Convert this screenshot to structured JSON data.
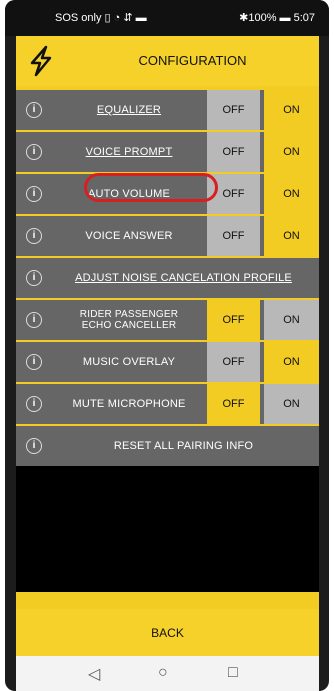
{
  "status": {
    "left": "SOS only ▯ ◔ ⇵ ▬",
    "right": "✱100% ▬ 5:07"
  },
  "header": {
    "title": "CONFIGURATION"
  },
  "rows": [
    {
      "label": "EQUALIZER",
      "off": "OFF",
      "on": "ON"
    },
    {
      "label": "VOICE PROMPT",
      "off": "OFF",
      "on": "ON"
    },
    {
      "label": "AUTO VOLUME",
      "off": "OFF",
      "on": "ON"
    },
    {
      "label": "VOICE ANSWER",
      "off": "OFF",
      "on": "ON"
    },
    {
      "label": "ADJUST NOISE CANCELATION PROFILE"
    },
    {
      "label": "RIDER PASSENGER ECHO CANCELLER",
      "off": "OFF",
      "on": "ON"
    },
    {
      "label": "MUSIC OVERLAY",
      "off": "OFF",
      "on": "ON"
    },
    {
      "label": "MUTE MICROPHONE",
      "off": "OFF",
      "on": "ON"
    },
    {
      "label": "RESET ALL PAIRING INFO"
    }
  ],
  "back_label": "BACK",
  "nav": {
    "back": "◁",
    "home": "○",
    "recents": "□"
  },
  "colors": {
    "accent": "#f2cc22",
    "row_bg": "#666666",
    "inactive": "#b8b8b8",
    "highlight": "#d62020"
  }
}
